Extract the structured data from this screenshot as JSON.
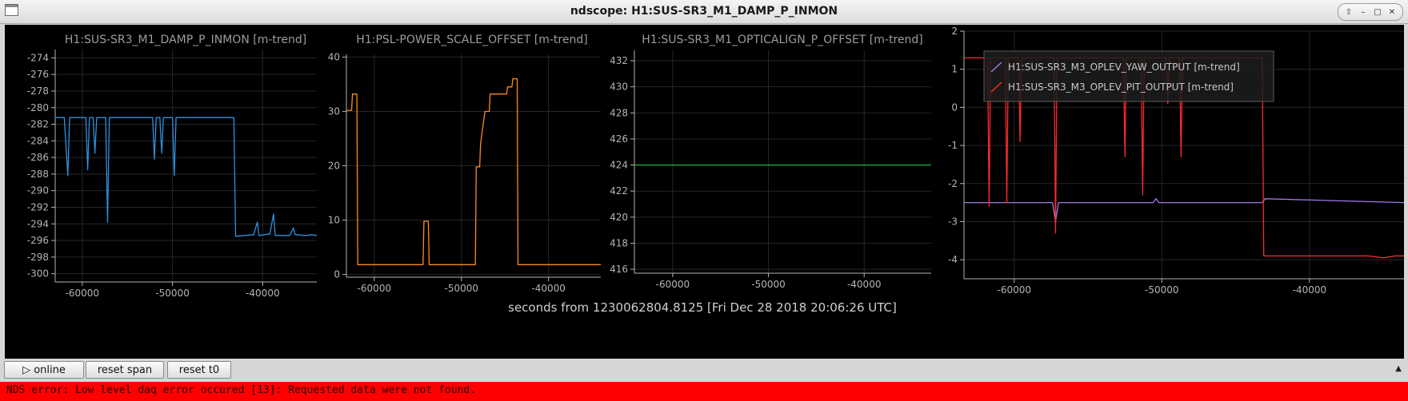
{
  "window": {
    "title": "ndscope: H1:SUS-SR3_M1_DAMP_P_INMON",
    "buttons": [
      "⇧",
      "–",
      "□",
      "✕"
    ]
  },
  "colors": {
    "blue": "#2e90e0",
    "orange": "#ff8a1c",
    "green": "#22b43a",
    "red": "#ff2a2a",
    "purple": "#a07ae8",
    "axis": "#b4b4b4",
    "grid": "#262626"
  },
  "plots": [
    {
      "title": "H1:SUS-SR3_M1_DAMP_P_INMON [m-trend]",
      "y_ticks": [
        "-274",
        "-276",
        "-278",
        "-280",
        "-282",
        "-284",
        "-286",
        "-288",
        "-290",
        "-292",
        "-294",
        "-296",
        "-298",
        "-300"
      ],
      "x_ticks": [
        "-60000",
        "-50000",
        "-40000"
      ]
    },
    {
      "title": "H1:PSL-POWER_SCALE_OFFSET [m-trend]",
      "y_ticks": [
        "40",
        "30",
        "20",
        "10",
        "0"
      ],
      "x_ticks": [
        "-60000",
        "-50000",
        "-40000"
      ]
    },
    {
      "title": "H1:SUS-SR3_M1_OPTICALIGN_P_OFFSET [m-trend]",
      "y_ticks": [
        "432",
        "430",
        "428",
        "426",
        "424",
        "422",
        "420",
        "418",
        "416"
      ],
      "x_ticks": [
        "-60000",
        "-50000",
        "-40000"
      ]
    },
    {
      "title": "",
      "y_ticks": [
        "2",
        "1",
        "0",
        "-1",
        "-2",
        "-3",
        "-4"
      ],
      "x_ticks": [
        "-60000",
        "-50000",
        "-40000"
      ],
      "legend": [
        "H1:SUS-SR3_M3_OPLEV_YAW_OUTPUT [m-trend]",
        "H1:SUS-SR3_M3_OPLEV_PIT_OUTPUT [m-trend]"
      ]
    }
  ],
  "x_axis_label": "seconds from 1230062804.8125 [Fri Dec 28 2018 20:06:26 UTC]",
  "chart_data": [
    {
      "type": "line",
      "title": "H1:SUS-SR3_M1_DAMP_P_INMON [m-trend]",
      "xlim": [
        -63000,
        -34000
      ],
      "ylim": [
        -301,
        -273
      ],
      "series": [
        {
          "values": [
            [
              -63000,
              -281.2
            ],
            [
              -62000,
              -281.2
            ],
            [
              -61600,
              -288.2
            ],
            [
              -61400,
              -281.2
            ],
            [
              -59600,
              -281.2
            ],
            [
              -59400,
              -287.5
            ],
            [
              -59200,
              -281.2
            ],
            [
              -58800,
              -281.2
            ],
            [
              -58600,
              -285.5
            ],
            [
              -58400,
              -281.2
            ],
            [
              -57400,
              -281.2
            ],
            [
              -57200,
              -293.8
            ],
            [
              -57000,
              -281.2
            ],
            [
              -52200,
              -281.2
            ],
            [
              -52000,
              -286.2
            ],
            [
              -51800,
              -281.2
            ],
            [
              -51400,
              -281.2
            ],
            [
              -51200,
              -285.5
            ],
            [
              -51000,
              -281.2
            ],
            [
              -50000,
              -281.2
            ],
            [
              -49800,
              -288.2
            ],
            [
              -49600,
              -281.2
            ],
            [
              -43200,
              -281.2
            ],
            [
              -43000,
              -295.5
            ],
            [
              -41000,
              -295.3
            ],
            [
              -40600,
              -293.8
            ],
            [
              -40400,
              -295.4
            ],
            [
              -39200,
              -295.2
            ],
            [
              -38800,
              -292.8
            ],
            [
              -38600,
              -295.4
            ],
            [
              -37000,
              -295.4
            ],
            [
              -36600,
              -294.5
            ],
            [
              -36400,
              -295.3
            ],
            [
              -35200,
              -295.4
            ],
            [
              -34600,
              -295.3
            ],
            [
              -34000,
              -295.4
            ]
          ]
        }
      ]
    },
    {
      "type": "line",
      "title": "H1:PSL-POWER_SCALE_OFFSET [m-trend]",
      "xlim": [
        -63200,
        -34000
      ],
      "ylim": [
        -0.5,
        40.5
      ],
      "series": [
        {
          "values": [
            [
              -63200,
              30.2
            ],
            [
              -62600,
              30.2
            ],
            [
              -62500,
              33.2
            ],
            [
              -62000,
              33.2
            ],
            [
              -61900,
              1.8
            ],
            [
              -54400,
              1.8
            ],
            [
              -54300,
              9.8
            ],
            [
              -53800,
              9.8
            ],
            [
              -53700,
              1.8
            ],
            [
              -48400,
              1.8
            ],
            [
              -48300,
              19.8
            ],
            [
              -47900,
              19.8
            ],
            [
              -47800,
              24
            ],
            [
              -47600,
              26.5
            ],
            [
              -47300,
              30
            ],
            [
              -46800,
              30
            ],
            [
              -46700,
              33.2
            ],
            [
              -44800,
              33.2
            ],
            [
              -44700,
              34.5
            ],
            [
              -44200,
              34.5
            ],
            [
              -44100,
              36
            ],
            [
              -43600,
              36
            ],
            [
              -43500,
              1.8
            ],
            [
              -34000,
              1.8
            ]
          ]
        }
      ]
    },
    {
      "type": "line",
      "title": "H1:SUS-SR3_M1_OPTICALIGN_P_OFFSET [m-trend]",
      "xlim": [
        -64000,
        -33000
      ],
      "ylim": [
        415.7,
        432.8
      ],
      "series": [
        {
          "values": [
            [
              -64000,
              424
            ],
            [
              -33000,
              424
            ]
          ]
        }
      ]
    },
    {
      "type": "line",
      "title": "",
      "xlim": [
        -63400,
        -33600
      ],
      "ylim": [
        -4.5,
        2.0
      ],
      "series": [
        {
          "name": "H1:SUS-SR3_M3_OPLEV_YAW_OUTPUT [m-trend]",
          "values": [
            [
              -63400,
              -2.5
            ],
            [
              -57400,
              -2.5
            ],
            [
              -57200,
              -3.0
            ],
            [
              -57000,
              -2.5
            ],
            [
              -50600,
              -2.5
            ],
            [
              -50400,
              -2.4
            ],
            [
              -50200,
              -2.5
            ],
            [
              -43200,
              -2.5
            ],
            [
              -43000,
              -2.4
            ],
            [
              -33600,
              -2.5
            ]
          ]
        },
        {
          "name": "H1:SUS-SR3_M3_OPLEV_PIT_OUTPUT [m-trend]",
          "values": [
            [
              -63400,
              1.3
            ],
            [
              -61800,
              1.3
            ],
            [
              -61700,
              -2.6
            ],
            [
              -61600,
              1.3
            ],
            [
              -60600,
              1.3
            ],
            [
              -60500,
              -2.5
            ],
            [
              -60400,
              1.3
            ],
            [
              -59700,
              1.3
            ],
            [
              -59600,
              -0.9
            ],
            [
              -59500,
              1.3
            ],
            [
              -57300,
              1.3
            ],
            [
              -57200,
              -3.3
            ],
            [
              -57100,
              1.3
            ],
            [
              -52600,
              1.3
            ],
            [
              -52500,
              -1.3
            ],
            [
              -52400,
              1.3
            ],
            [
              -51400,
              1.3
            ],
            [
              -51300,
              -2.3
            ],
            [
              -51200,
              1.3
            ],
            [
              -49700,
              1.3
            ],
            [
              -49600,
              0.1
            ],
            [
              -49500,
              1.3
            ],
            [
              -48800,
              1.3
            ],
            [
              -48700,
              -1.3
            ],
            [
              -48600,
              1.3
            ],
            [
              -43200,
              1.3
            ],
            [
              -43100,
              -3.9
            ],
            [
              -36000,
              -3.9
            ],
            [
              -35000,
              -3.95
            ],
            [
              -34200,
              -3.9
            ],
            [
              -33600,
              -3.9
            ]
          ]
        }
      ]
    }
  ],
  "toolbar": {
    "online_label": "▷ online",
    "reset_span_label": "reset span",
    "reset_t0_label": "reset t0"
  },
  "status": {
    "error": "NDS error: Low level daq error occured [13]: Requested data were not found."
  }
}
